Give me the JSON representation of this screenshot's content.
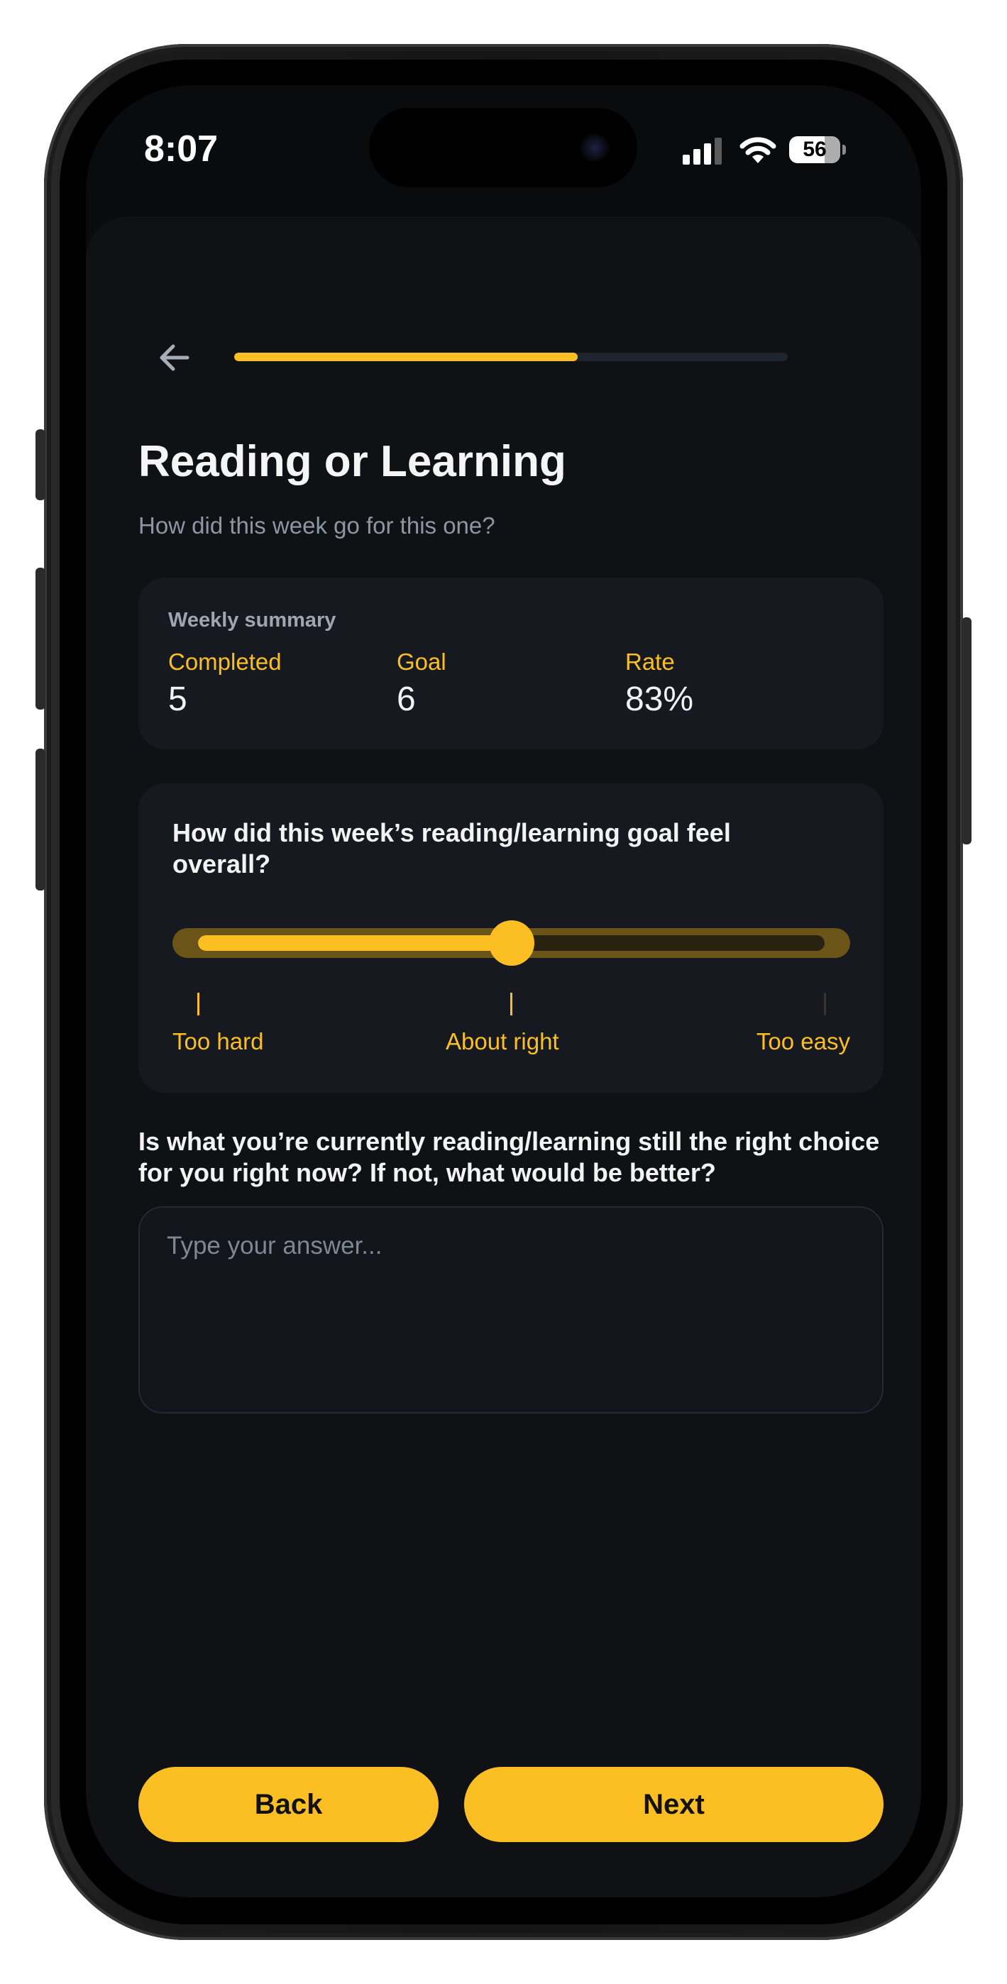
{
  "status_bar": {
    "time": "8:07",
    "battery": "56"
  },
  "header": {
    "back_icon": "arrow-left-icon",
    "progress": 0.62
  },
  "page": {
    "title": "Reading or Learning",
    "subtitle": "How did this week go for this one?"
  },
  "summary": {
    "heading": "Weekly summary",
    "stats": [
      {
        "label": "Completed",
        "value": "5"
      },
      {
        "label": "Goal",
        "value": "6"
      },
      {
        "label": "Rate",
        "value": "83%"
      }
    ]
  },
  "feel": {
    "question": "How did this week’s reading/learning goal feel overall?",
    "value": 0.5,
    "labels": {
      "low": "Too hard",
      "mid": "About right",
      "high": "Too easy"
    }
  },
  "question2": {
    "text": "Is what you’re currently reading/learning still the right choice for you right now? If not, what would be better?",
    "value": "",
    "placeholder": "Type your answer..."
  },
  "buttons": {
    "back": "Back",
    "next": "Next"
  },
  "colors": {
    "accent": "#fbbf24",
    "background": "#0a0b0d",
    "card": "#161a20"
  }
}
